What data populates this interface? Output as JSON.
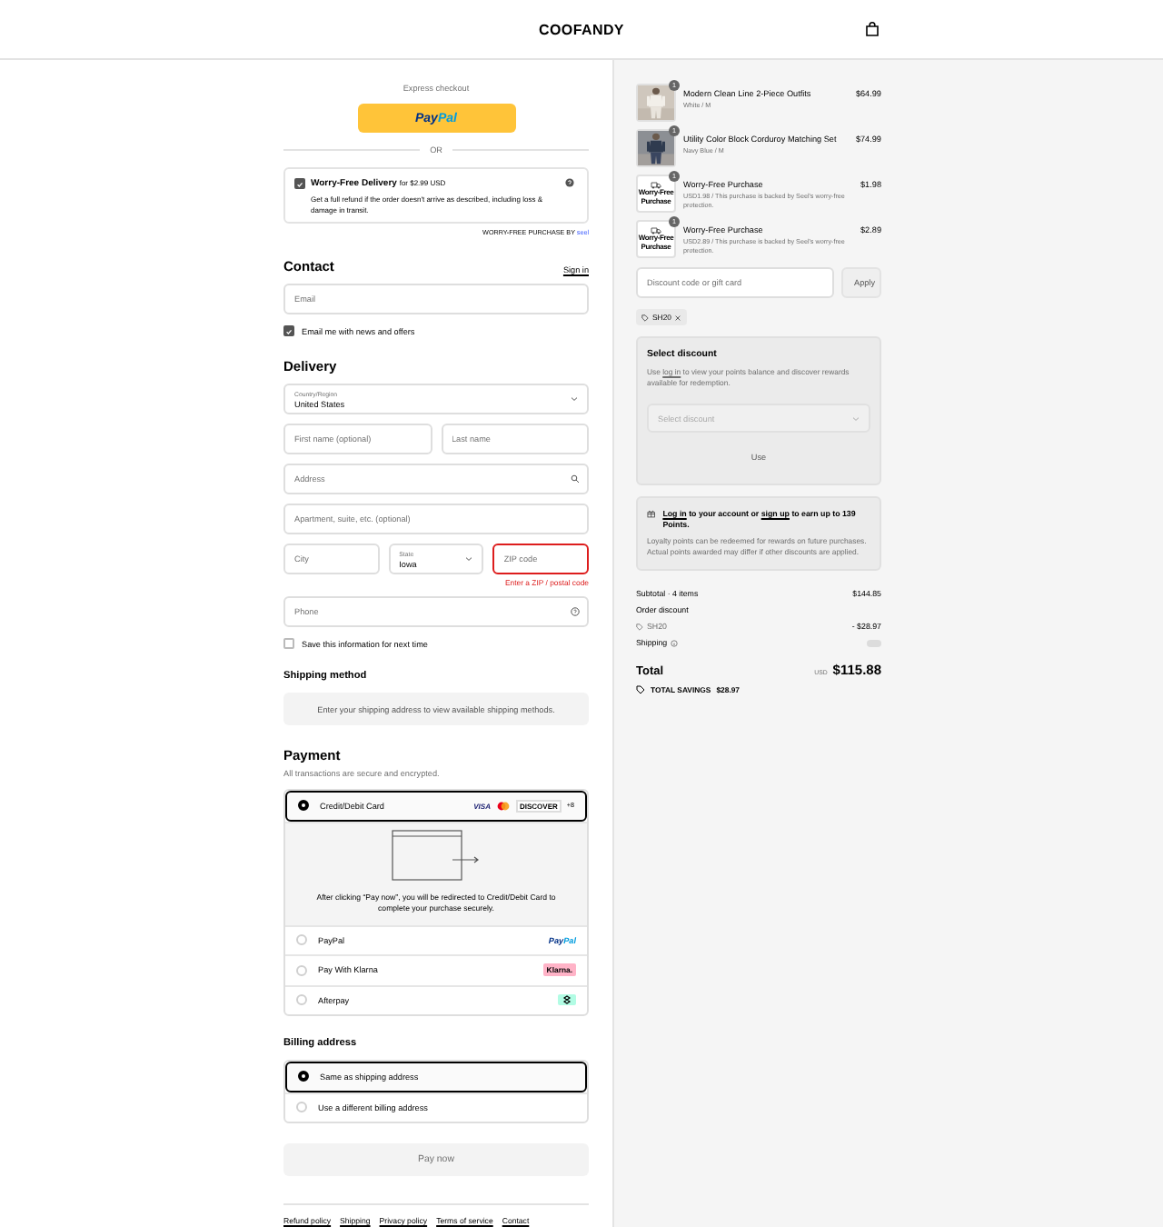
{
  "header": {
    "logo": "COOFANDY"
  },
  "express": {
    "title": "Express checkout",
    "paypal": [
      "Pay",
      "Pal"
    ],
    "or_label": "OR"
  },
  "protection": {
    "checked": true,
    "title": "Worry-Free Delivery",
    "price": "for $2.99 USD",
    "description": "Get a full refund if the order doesn't arrive as described, including loss & damage in transit.",
    "provider_label": "WORRY-FREE PURCHASE BY",
    "provider": "seel"
  },
  "contact": {
    "heading": "Contact",
    "sign_in": "Sign in",
    "email": {
      "placeholder": "Email"
    },
    "news": {
      "label": "Email me with news and offers",
      "checked": true
    }
  },
  "delivery": {
    "heading": "Delivery",
    "country": {
      "label": "Country/Region",
      "value": "United States"
    },
    "first_name": {
      "placeholder": "First name (optional)"
    },
    "last_name": {
      "placeholder": "Last name"
    },
    "address": {
      "placeholder": "Address"
    },
    "apartment": {
      "placeholder": "Apartment, suite, etc. (optional)"
    },
    "city": {
      "placeholder": "City"
    },
    "state": {
      "label": "State",
      "value": "Iowa"
    },
    "zip": {
      "placeholder": "ZIP code",
      "invalid": true,
      "error": "Enter a ZIP / postal code"
    },
    "phone": {
      "placeholder": "Phone"
    },
    "save_info": {
      "label": "Save this information for next time",
      "checked": false
    }
  },
  "shipping_method": {
    "heading": "Shipping method",
    "message": "Enter your shipping address to view available shipping methods."
  },
  "payment": {
    "heading": "Payment",
    "subtitle": "All transactions are secure and encrypted.",
    "methods": [
      {
        "kind": "card",
        "label": "Credit/Debit Card",
        "selected": true,
        "brands": [
          {
            "kind": "visa",
            "text": "VISA"
          },
          {
            "kind": "mastercard"
          },
          {
            "kind": "discover",
            "text": "DISCOVER"
          },
          {
            "kind": "more",
            "text": "+8"
          }
        ]
      },
      {
        "kind": "paypal",
        "label": "PayPal",
        "selected": false,
        "logo": [
          "Pay",
          "Pal"
        ]
      },
      {
        "kind": "klarna",
        "label": "Pay With Klarna",
        "selected": false,
        "logo": [
          "Klarna."
        ]
      },
      {
        "kind": "afterpay",
        "label": "Afterpay",
        "selected": false
      }
    ],
    "redirect_note": "After clicking “Pay now”, you will be redirected to Credit/Debit Card to complete your purchase securely."
  },
  "billing": {
    "heading": "Billing address",
    "options": [
      {
        "label": "Same as shipping address",
        "selected": true
      },
      {
        "label": "Use a different billing address",
        "selected": false
      }
    ]
  },
  "pay_button": {
    "label": "Pay now",
    "disabled": true
  },
  "footer_links": [
    "Refund policy",
    "Shipping",
    "Privacy policy",
    "Terms of service",
    "Contact"
  ],
  "summary": {
    "items": [
      {
        "kind": "product",
        "quantity": "1",
        "name": "Modern Clean Line 2-Piece Outfits",
        "variant": "White / M",
        "price": "$64.99"
      },
      {
        "kind": "product",
        "quantity": "1",
        "name": "Utility Color Block Corduroy Matching Set",
        "variant": "Navy Blue / M",
        "price": "$74.99"
      },
      {
        "kind": "protection",
        "quantity": "1",
        "thumb_label": "Worry-Free Purchase",
        "name": "Worry-Free Purchase",
        "variant": "USD1.98 / This purchase is backed by Seel's worry-free protection.",
        "price": "$1.98"
      },
      {
        "kind": "protection",
        "quantity": "1",
        "thumb_label": "Worry-Free Purchase",
        "name": "Worry-Free Purchase",
        "variant": "USD2.89 / This purchase is backed by Seel's worry-free protection.",
        "price": "$2.89"
      }
    ],
    "discount_field": {
      "placeholder": "Discount code or gift card"
    },
    "apply_button": "Apply",
    "applied_code": "SH20",
    "select_discount": {
      "heading": "Select discount",
      "text": {
        "before": "Use",
        "link": "log in",
        "after": "to view your points balance and discover rewards available for redemption."
      },
      "select": {
        "placeholder": "Select discount"
      },
      "button": "Use"
    },
    "loyalty": {
      "title": {
        "link1": "Log in",
        "middle": "to your account or",
        "link2": "sign up",
        "after": "to earn up to 139 Points."
      },
      "description": "Loyalty points can be redeemed for rewards on future purchases. Actual points awarded may differ if other discounts are applied."
    },
    "subtotal": {
      "label": "Subtotal · 4 items",
      "value": "$144.85"
    },
    "order_discount": {
      "label": "Order discount",
      "code": "SH20",
      "value": "- $28.97"
    },
    "shipping": {
      "label": "Shipping"
    },
    "total": {
      "label": "Total",
      "currency": "USD",
      "value": "$115.88"
    },
    "savings": {
      "label": "TOTAL SAVINGS",
      "value": "$28.97"
    }
  }
}
